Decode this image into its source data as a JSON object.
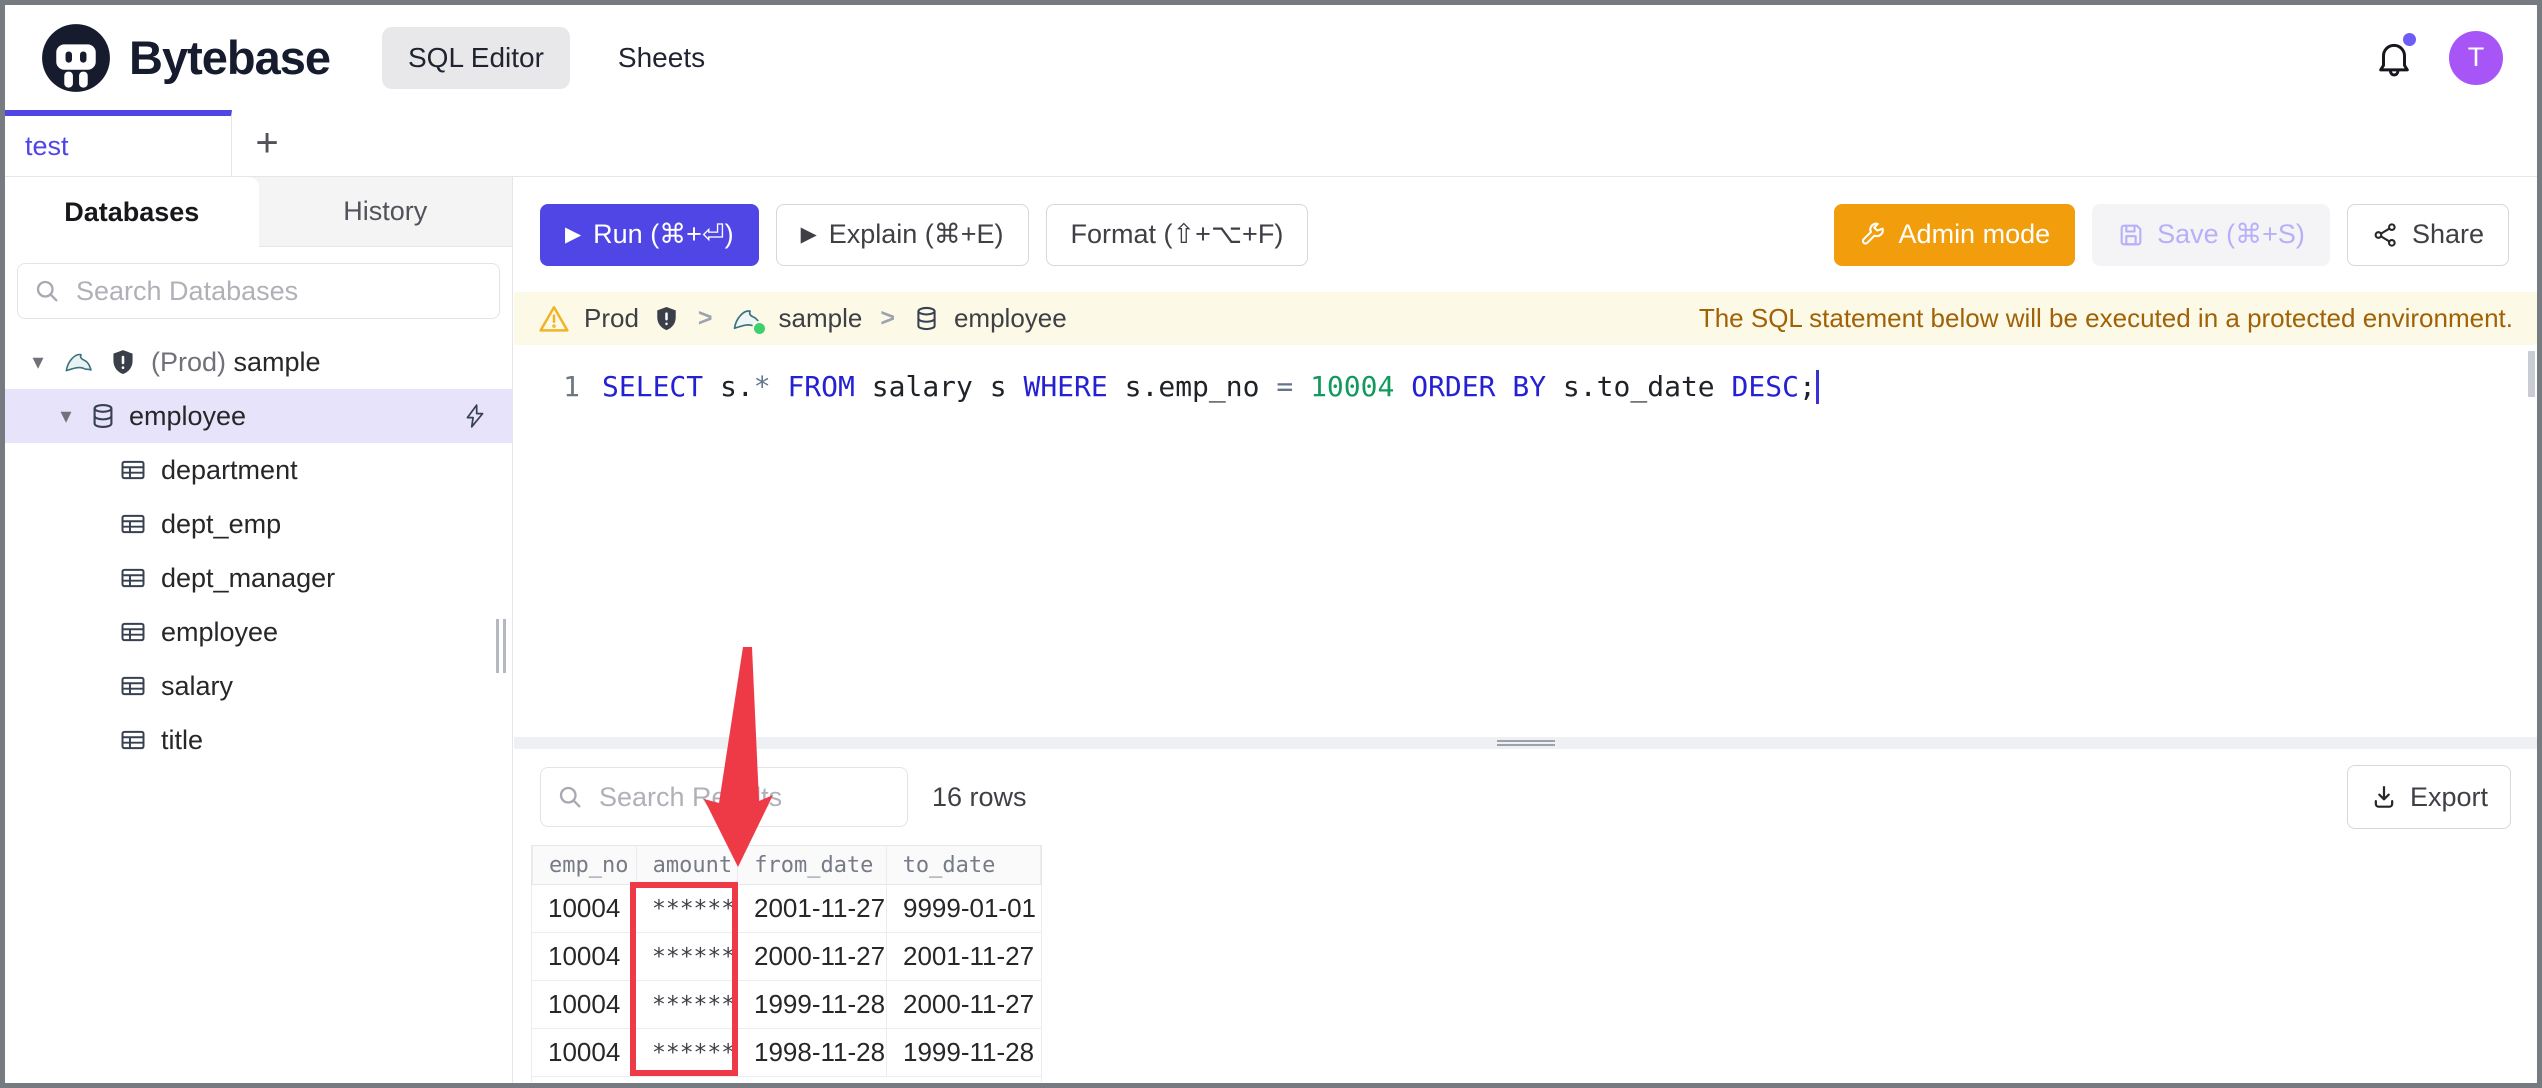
{
  "ui_colors": {
    "accent_indigo": "#4f46e5",
    "admin_orange": "#f29d0b",
    "banner_bg": "#fcf9e6",
    "banner_text": "#a16207",
    "annotation_red": "#ee3a47",
    "avatar_purple": "#a855f7",
    "selected_tree_row_bg": "#e6e3fb",
    "sql_keyword": "#2521d3",
    "sql_number": "#12995c"
  },
  "topbar": {
    "brand": "Bytebase",
    "nav_sql_editor": "SQL Editor",
    "nav_sheets": "Sheets",
    "avatar_initial": "T"
  },
  "tabstrip": {
    "tab_test": "test",
    "add_tab": "+"
  },
  "sidebar": {
    "tab_databases": "Databases",
    "tab_history": "History",
    "search_placeholder": "Search Databases",
    "root_prefix": "(Prod)",
    "root_name": "sample",
    "database": "employee",
    "tables": [
      "department",
      "dept_emp",
      "dept_manager",
      "employee",
      "salary",
      "title"
    ]
  },
  "toolbar": {
    "run": "Run (⌘+⏎)",
    "explain": "Explain (⌘+E)",
    "format": "Format (⇧+⌥+F)",
    "admin_mode": "Admin mode",
    "save": "Save (⌘+S)",
    "share": "Share"
  },
  "banner": {
    "environment": "Prod",
    "database": "sample",
    "table": "employee",
    "sep": ">",
    "warning": "The SQL statement below will be executed in a protected environment."
  },
  "editor": {
    "line_number": "1",
    "tokens": [
      "SELECT",
      " s.",
      "*",
      " ",
      "FROM",
      " salary s ",
      "WHERE",
      " s.emp_no ",
      "=",
      " ",
      "10004",
      " ",
      "ORDER BY",
      " s.to_date ",
      "DESC",
      ";"
    ]
  },
  "results": {
    "search_placeholder": "Search Results",
    "row_count": "16 rows",
    "export_label": "Export",
    "columns": [
      "emp_no",
      "amount",
      "from_date",
      "to_date"
    ],
    "rows": [
      [
        "10004",
        "******",
        "2001-11-27",
        "9999-01-01"
      ],
      [
        "10004",
        "******",
        "2000-11-27",
        "2001-11-27"
      ],
      [
        "10004",
        "******",
        "1999-11-28",
        "2000-11-27"
      ],
      [
        "10004",
        "******",
        "1998-11-28",
        "1999-11-28"
      ]
    ]
  }
}
